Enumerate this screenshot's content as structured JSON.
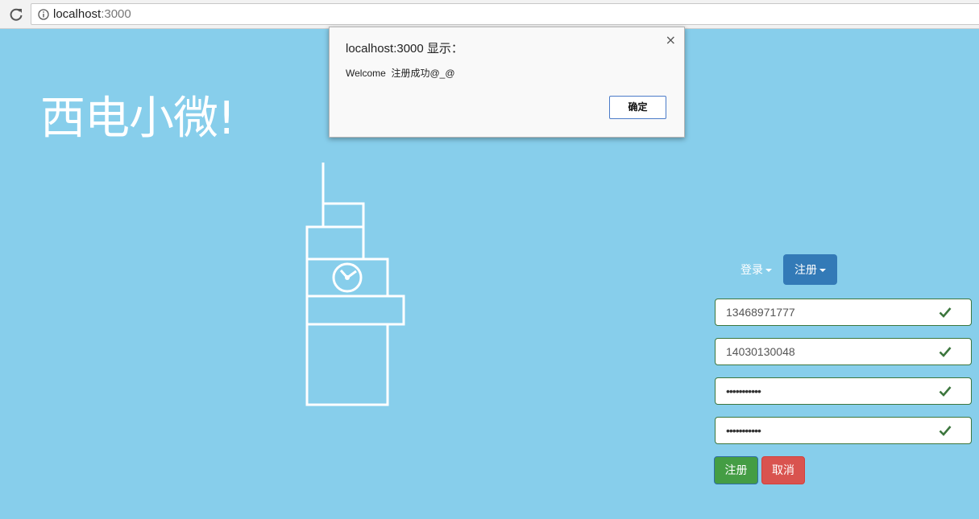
{
  "browser": {
    "url_host": "localhost",
    "url_port": ":3000",
    "reload_icon": "reload-icon",
    "info_icon": "info-icon"
  },
  "page": {
    "brand": "西电小微!",
    "background_color": "#87ceeb"
  },
  "auth": {
    "tabs": [
      {
        "label": "登录",
        "active": false
      },
      {
        "label": "注册",
        "active": true
      }
    ],
    "fields": [
      {
        "value": "13468971777",
        "type": "text",
        "valid": true
      },
      {
        "value": "14030130048",
        "type": "text",
        "valid": true
      },
      {
        "value": "•••••••••••",
        "type": "password",
        "valid": true
      },
      {
        "value": "•••••••••••",
        "type": "password",
        "valid": true
      }
    ],
    "buttons": {
      "register": "注册",
      "cancel": "取消"
    },
    "colors": {
      "active_tab": "#337ab7",
      "register_btn": "#449d44",
      "cancel_btn": "#d9534f",
      "valid": "#3c763d"
    }
  },
  "dialog": {
    "title": "localhost:3000 显示：",
    "message": "Welcome  注册成功@_@",
    "ok_label": "确定",
    "close_symbol": "×"
  }
}
